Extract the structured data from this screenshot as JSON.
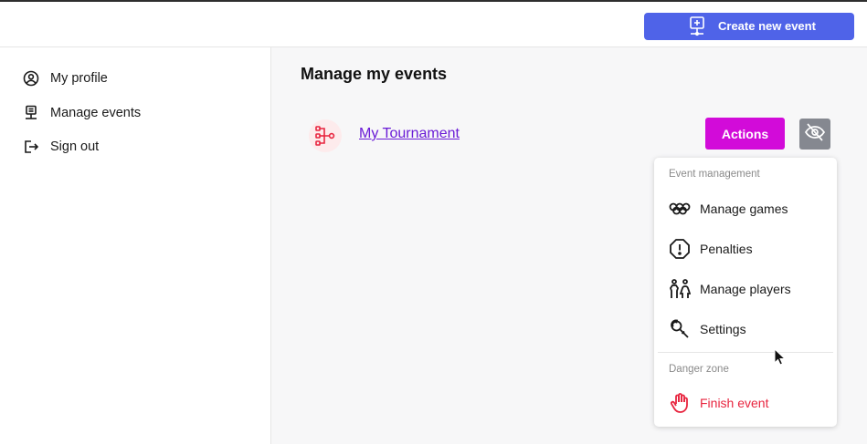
{
  "header": {
    "create_button_label": "Create new event",
    "create_icon": "calendar-plus-icon"
  },
  "sidebar": {
    "items": [
      {
        "label": "My profile",
        "icon": "user-circle-icon"
      },
      {
        "label": "Manage events",
        "icon": "event-monitor-icon"
      },
      {
        "label": "Sign out",
        "icon": "sign-out-icon"
      }
    ]
  },
  "main": {
    "title": "Manage my events",
    "events": [
      {
        "name": "My Tournament",
        "icon": "tournament-bracket-icon",
        "actions_label": "Actions",
        "visibility_icon": "eye-off-icon"
      }
    ]
  },
  "actions_menu": {
    "section_management": "Event management",
    "items": [
      {
        "label": "Manage games",
        "icon": "rings-icon"
      },
      {
        "label": "Penalties",
        "icon": "alert-octagon-icon"
      },
      {
        "label": "Manage players",
        "icon": "players-icon"
      },
      {
        "label": "Settings",
        "icon": "tools-icon"
      }
    ],
    "section_danger": "Danger zone",
    "danger_items": [
      {
        "label": "Finish event",
        "icon": "stop-hand-icon"
      }
    ]
  },
  "colors": {
    "primary": "#4f63e8",
    "actions": "#d20bd9",
    "link": "#6a1bd6",
    "danger": "#e8253f",
    "muted_button": "#858890"
  }
}
